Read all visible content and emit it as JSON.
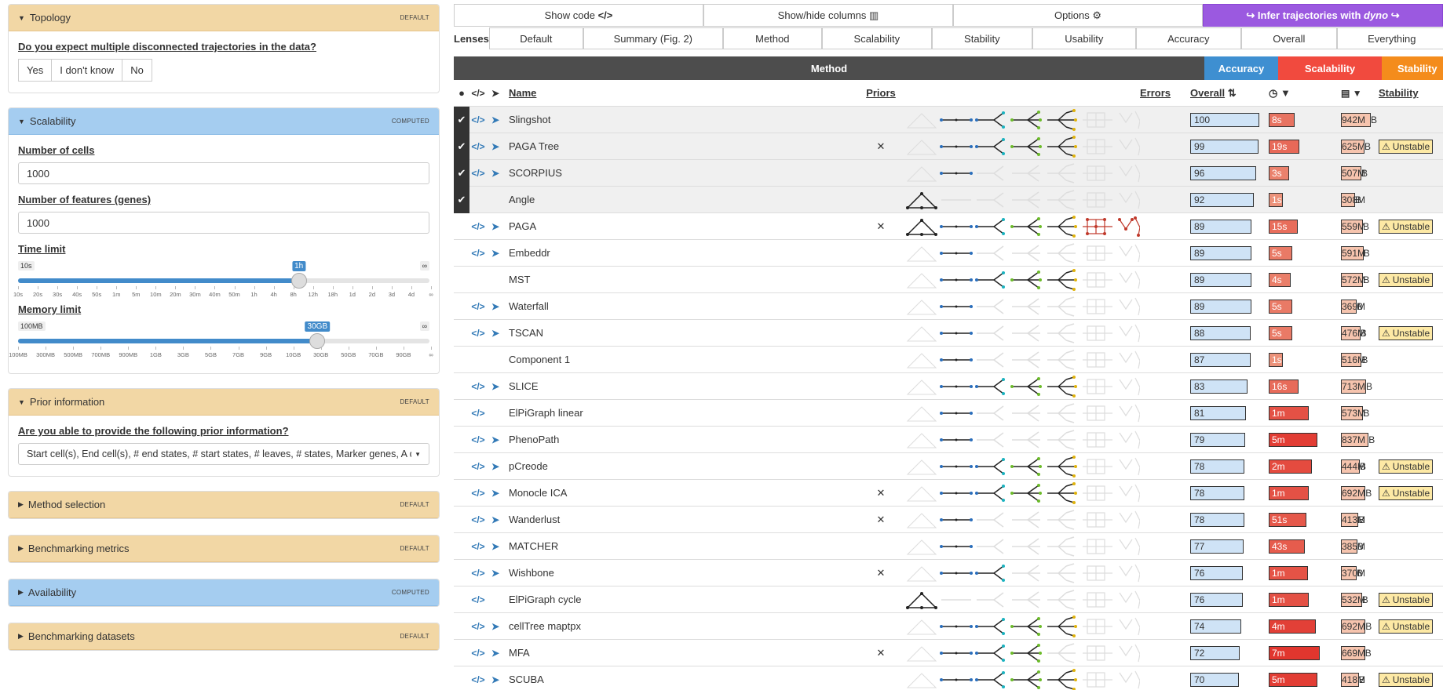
{
  "left": {
    "topology": {
      "title": "Topology",
      "badge": "DEFAULT",
      "question": "Do you expect multiple disconnected trajectories in the data?",
      "options": [
        "Yes",
        "I don't know",
        "No"
      ]
    },
    "scalability": {
      "title": "Scalability",
      "badge": "COMPUTED",
      "cells_label": "Number of cells",
      "cells_value": "1000",
      "features_label": "Number of features (genes)",
      "features_value": "1000",
      "time_label": "Time limit",
      "time_min": "10s",
      "time_max": "∞",
      "time_value": "1h",
      "time_fraction": 0.68,
      "time_ticks": [
        "10s",
        "20s",
        "30s",
        "40s",
        "50s",
        "1m",
        "5m",
        "10m",
        "20m",
        "30m",
        "40m",
        "50m",
        "1h",
        "4h",
        "8h",
        "12h",
        "18h",
        "1d",
        "2d",
        "3d",
        "4d",
        "∞"
      ],
      "memory_label": "Memory limit",
      "memory_min": "100MB",
      "memory_max": "∞",
      "memory_value": "30GB",
      "memory_fraction": 0.725,
      "memory_ticks": [
        "100MB",
        "300MB",
        "500MB",
        "700MB",
        "900MB",
        "1GB",
        "3GB",
        "5GB",
        "7GB",
        "9GB",
        "10GB",
        "30GB",
        "50GB",
        "70GB",
        "90GB",
        "∞"
      ]
    },
    "prior": {
      "title": "Prior information",
      "badge": "DEFAULT",
      "question": "Are you able to provide the following prior information?",
      "value": "Start cell(s), End cell(s), # end states, # start states, # leaves, # states, Marker genes, A di"
    },
    "method_selection": {
      "title": "Method selection",
      "badge": "DEFAULT"
    },
    "benchmarking_metrics": {
      "title": "Benchmarking metrics",
      "badge": "DEFAULT"
    },
    "availability": {
      "title": "Availability",
      "badge": "COMPUTED"
    },
    "benchmarking_datasets": {
      "title": "Benchmarking datasets",
      "badge": "DEFAULT"
    }
  },
  "toolbar": {
    "show_code": "Show code",
    "show_hide": "Show/hide columns",
    "options": "Options",
    "infer_pre": "Infer trajectories with",
    "infer_em": "dyno"
  },
  "lenses": {
    "label": "Lenses",
    "items": [
      "Default",
      "Summary (Fig. 2)",
      "Method",
      "Scalability",
      "Stability",
      "Usability",
      "Accuracy",
      "Overall",
      "Everything"
    ]
  },
  "groups": {
    "method": "Method",
    "accuracy": "Accuracy",
    "scalability": "Scalability",
    "stability": "Stability"
  },
  "columns": {
    "name": "Name",
    "priors": "Priors",
    "errors": "Errors",
    "overall": "Overall",
    "stability": "Stability"
  },
  "unstable_label": "Unstable",
  "colors": {
    "accuracy": "#3e8fd1",
    "scalability": "#f14a3e",
    "stability": "#f48c1c",
    "method": "#4d4d4d",
    "infer": "#9b59e0"
  },
  "methods": [
    {
      "name": "Slingshot",
      "sel": true,
      "code": true,
      "plane": true,
      "prior": "",
      "overall": 100,
      "time": "8s",
      "time_frac": 0.38,
      "mem": "942M",
      "mem_unit": "B",
      "mem_frac": 0.95,
      "unstable": false,
      "topo": [
        0,
        1,
        1,
        1,
        1,
        0,
        0
      ]
    },
    {
      "name": "PAGA Tree",
      "sel": true,
      "code": true,
      "plane": true,
      "prior": "✕",
      "overall": 99,
      "time": "19s",
      "time_frac": 0.44,
      "mem": "625M",
      "mem_unit": "B",
      "mem_frac": 0.75,
      "unstable": true,
      "topo": [
        0,
        1,
        1,
        1,
        1,
        0,
        0
      ]
    },
    {
      "name": "SCORPIUS",
      "sel": true,
      "code": true,
      "plane": true,
      "prior": "",
      "overall": 96,
      "time": "3s",
      "time_frac": 0.3,
      "mem": "507M",
      "mem_unit": "B",
      "mem_frac": 0.65,
      "unstable": false,
      "topo": [
        0,
        1,
        0,
        0,
        0,
        0,
        0
      ]
    },
    {
      "name": "Angle",
      "sel": true,
      "code": false,
      "plane": false,
      "prior": "",
      "overall": 92,
      "time": "1s",
      "time_frac": 0.2,
      "mem": "308M",
      "mem_unit": "B",
      "mem_frac": 0.45,
      "unstable": false,
      "topo": [
        1,
        0,
        0,
        0,
        0,
        0,
        0
      ]
    },
    {
      "name": "PAGA",
      "sel": false,
      "code": true,
      "plane": true,
      "prior": "✕",
      "overall": 89,
      "time": "15s",
      "time_frac": 0.42,
      "mem": "559M",
      "mem_unit": "B",
      "mem_frac": 0.7,
      "unstable": true,
      "topo": [
        1,
        1,
        1,
        1,
        1,
        1,
        1
      ]
    },
    {
      "name": "Embeddr",
      "sel": false,
      "code": true,
      "plane": true,
      "prior": "",
      "overall": 89,
      "time": "5s",
      "time_frac": 0.34,
      "mem": "591M",
      "mem_unit": "B",
      "mem_frac": 0.72,
      "unstable": false,
      "topo": [
        0,
        1,
        0,
        0,
        0,
        0,
        0
      ]
    },
    {
      "name": "MST",
      "sel": false,
      "code": false,
      "plane": false,
      "prior": "",
      "overall": 89,
      "time": "4s",
      "time_frac": 0.32,
      "mem": "572M",
      "mem_unit": "B",
      "mem_frac": 0.71,
      "unstable": true,
      "topo": [
        0,
        1,
        1,
        1,
        1,
        0,
        0
      ]
    },
    {
      "name": "Waterfall",
      "sel": false,
      "code": true,
      "plane": true,
      "prior": "",
      "overall": 89,
      "time": "5s",
      "time_frac": 0.34,
      "mem": "369M",
      "mem_unit": "B",
      "mem_frac": 0.5,
      "unstable": false,
      "topo": [
        0,
        1,
        0,
        0,
        0,
        0,
        0
      ]
    },
    {
      "name": "TSCAN",
      "sel": false,
      "code": true,
      "plane": true,
      "prior": "",
      "overall": 88,
      "time": "5s",
      "time_frac": 0.34,
      "mem": "476M",
      "mem_unit": "B",
      "mem_frac": 0.62,
      "unstable": true,
      "topo": [
        0,
        1,
        0,
        0,
        0,
        0,
        0
      ]
    },
    {
      "name": "Component 1",
      "sel": false,
      "code": false,
      "plane": false,
      "prior": "",
      "overall": 87,
      "time": "1s",
      "time_frac": 0.2,
      "mem": "516M",
      "mem_unit": "B",
      "mem_frac": 0.66,
      "unstable": false,
      "topo": [
        0,
        1,
        0,
        0,
        0,
        0,
        0
      ]
    },
    {
      "name": "SLICE",
      "sel": false,
      "code": true,
      "plane": true,
      "prior": "",
      "overall": 83,
      "time": "16s",
      "time_frac": 0.43,
      "mem": "713M",
      "mem_unit": "B",
      "mem_frac": 0.8,
      "unstable": false,
      "topo": [
        0,
        1,
        1,
        1,
        1,
        0,
        0
      ]
    },
    {
      "name": "ElPiGraph linear",
      "sel": false,
      "code": true,
      "plane": false,
      "prior": "",
      "overall": 81,
      "time": "1m",
      "time_frac": 0.58,
      "mem": "573M",
      "mem_unit": "B",
      "mem_frac": 0.71,
      "unstable": false,
      "topo": [
        0,
        1,
        0,
        0,
        0,
        0,
        0
      ]
    },
    {
      "name": "PhenoPath",
      "sel": false,
      "code": true,
      "plane": true,
      "prior": "",
      "overall": 79,
      "time": "5m",
      "time_frac": 0.7,
      "mem": "837M",
      "mem_unit": "B",
      "mem_frac": 0.88,
      "unstable": false,
      "topo": [
        0,
        1,
        0,
        0,
        0,
        0,
        0
      ]
    },
    {
      "name": "pCreode",
      "sel": false,
      "code": true,
      "plane": true,
      "prior": "",
      "overall": 78,
      "time": "2m",
      "time_frac": 0.62,
      "mem": "444M",
      "mem_unit": "B",
      "mem_frac": 0.6,
      "unstable": true,
      "topo": [
        0,
        1,
        1,
        1,
        1,
        0,
        0
      ]
    },
    {
      "name": "Monocle ICA",
      "sel": false,
      "code": true,
      "plane": true,
      "prior": "✕",
      "overall": 78,
      "time": "1m",
      "time_frac": 0.58,
      "mem": "692M",
      "mem_unit": "B",
      "mem_frac": 0.78,
      "unstable": true,
      "topo": [
        0,
        1,
        1,
        1,
        1,
        0,
        0
      ]
    },
    {
      "name": "Wanderlust",
      "sel": false,
      "code": true,
      "plane": true,
      "prior": "✕",
      "overall": 78,
      "time": "51s",
      "time_frac": 0.54,
      "mem": "413M",
      "mem_unit": "B",
      "mem_frac": 0.56,
      "unstable": false,
      "topo": [
        0,
        1,
        0,
        0,
        0,
        0,
        0
      ]
    },
    {
      "name": "MATCHER",
      "sel": false,
      "code": true,
      "plane": true,
      "prior": "",
      "overall": 77,
      "time": "43s",
      "time_frac": 0.52,
      "mem": "385M",
      "mem_unit": "B",
      "mem_frac": 0.52,
      "unstable": false,
      "topo": [
        0,
        1,
        0,
        0,
        0,
        0,
        0
      ]
    },
    {
      "name": "Wishbone",
      "sel": false,
      "code": true,
      "plane": true,
      "prior": "✕",
      "overall": 76,
      "time": "1m",
      "time_frac": 0.57,
      "mem": "370M",
      "mem_unit": "B",
      "mem_frac": 0.5,
      "unstable": false,
      "topo": [
        0,
        1,
        1,
        0,
        0,
        0,
        0
      ]
    },
    {
      "name": "ElPiGraph cycle",
      "sel": false,
      "code": true,
      "plane": false,
      "prior": "",
      "overall": 76,
      "time": "1m",
      "time_frac": 0.58,
      "mem": "532M",
      "mem_unit": "B",
      "mem_frac": 0.67,
      "unstable": true,
      "topo": [
        1,
        0,
        0,
        0,
        0,
        0,
        0
      ]
    },
    {
      "name": "cellTree maptpx",
      "sel": false,
      "code": true,
      "plane": true,
      "prior": "",
      "overall": 74,
      "time": "4m",
      "time_frac": 0.68,
      "mem": "692M",
      "mem_unit": "B",
      "mem_frac": 0.78,
      "unstable": true,
      "topo": [
        0,
        1,
        1,
        1,
        1,
        0,
        0
      ]
    },
    {
      "name": "MFA",
      "sel": false,
      "code": true,
      "plane": true,
      "prior": "✕",
      "overall": 72,
      "time": "7m",
      "time_frac": 0.74,
      "mem": "669M",
      "mem_unit": "B",
      "mem_frac": 0.77,
      "unstable": false,
      "topo": [
        0,
        1,
        1,
        1,
        0,
        0,
        0
      ]
    },
    {
      "name": "SCUBA",
      "sel": false,
      "code": true,
      "plane": true,
      "prior": "",
      "overall": 70,
      "time": "5m",
      "time_frac": 0.7,
      "mem": "418M",
      "mem_unit": "B",
      "mem_frac": 0.57,
      "unstable": true,
      "topo": [
        0,
        1,
        1,
        1,
        1,
        0,
        0
      ]
    }
  ]
}
